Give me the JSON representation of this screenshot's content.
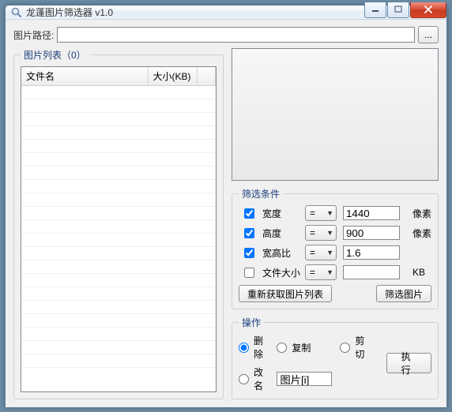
{
  "window": {
    "title": "龙蓬图片筛选器 v1.0"
  },
  "path": {
    "label": "图片路径:",
    "value": "",
    "browse": "..."
  },
  "list": {
    "legend": "图片列表（0）",
    "cols": {
      "name": "文件名",
      "size": "大小(KB)"
    }
  },
  "filter": {
    "legend": "筛选条件",
    "rows": {
      "width": {
        "checked": true,
        "label": "宽度",
        "op": "=",
        "value": "1440",
        "unit": "像素"
      },
      "height": {
        "checked": true,
        "label": "高度",
        "op": "=",
        "value": "900",
        "unit": "像素"
      },
      "ratio": {
        "checked": true,
        "label": "宽高比",
        "op": "=",
        "value": "1.6",
        "unit": ""
      },
      "size": {
        "checked": false,
        "label": "文件大小",
        "op": "=",
        "value": "",
        "unit": "KB"
      }
    },
    "btn_refresh": "重新获取图片列表",
    "btn_filter": "筛选图片"
  },
  "ops": {
    "legend": "操作",
    "delete": "删除",
    "copy": "复制",
    "cut": "剪切",
    "rename": "改名",
    "rename_value": "图片[i]",
    "exec": "执行",
    "selected": "delete"
  }
}
